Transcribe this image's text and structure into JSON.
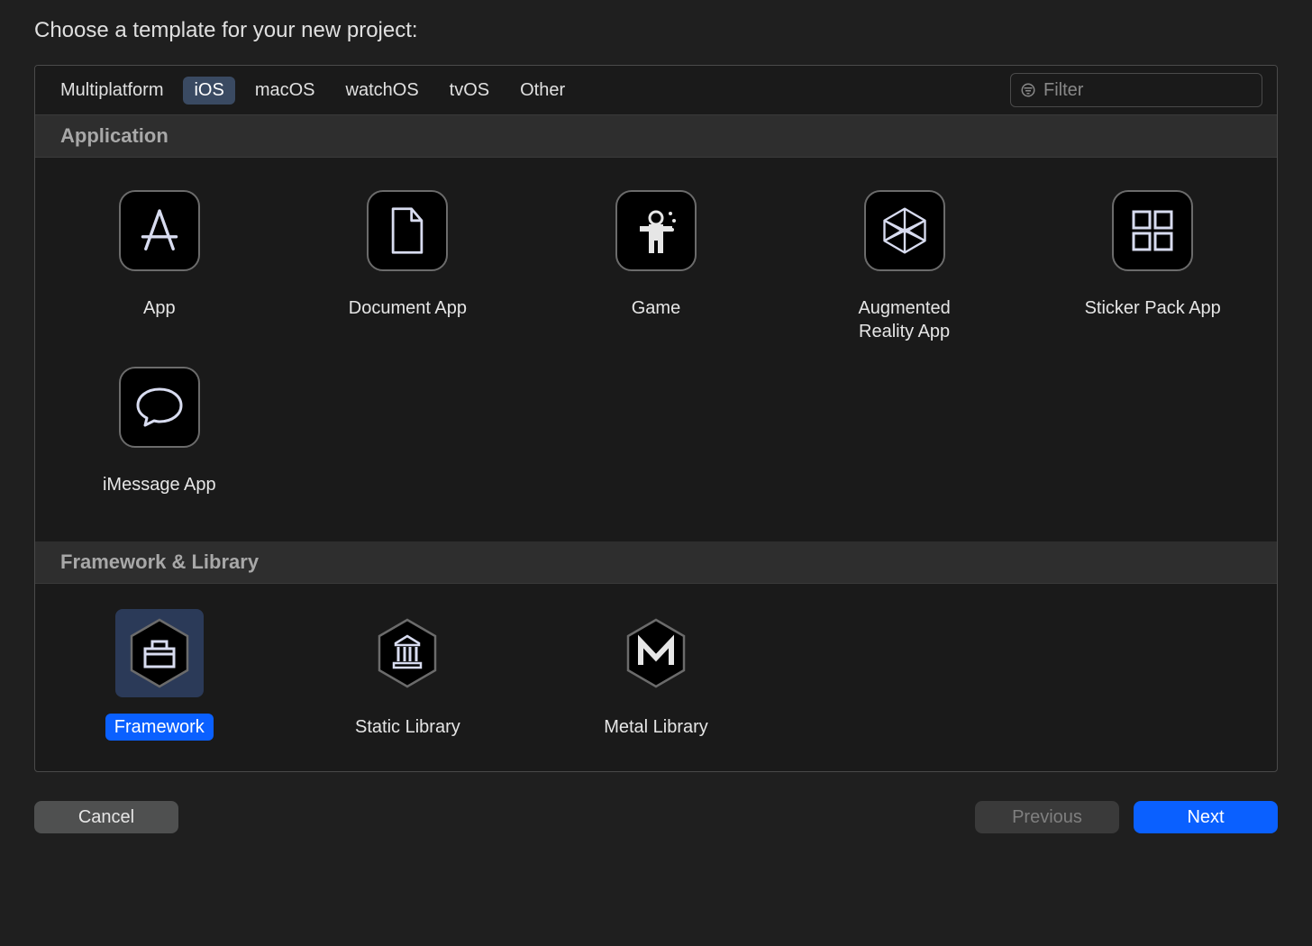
{
  "title": "Choose a template for your new project:",
  "tabs": [
    {
      "label": "Multiplatform",
      "selected": false
    },
    {
      "label": "iOS",
      "selected": true
    },
    {
      "label": "macOS",
      "selected": false
    },
    {
      "label": "watchOS",
      "selected": false
    },
    {
      "label": "tvOS",
      "selected": false
    },
    {
      "label": "Other",
      "selected": false
    }
  ],
  "filter": {
    "placeholder": "Filter",
    "value": ""
  },
  "sections": [
    {
      "title": "Application",
      "templates": [
        {
          "label": "App"
        },
        {
          "label": "Document App"
        },
        {
          "label": "Game"
        },
        {
          "label": "Augmented Reality App"
        },
        {
          "label": "Sticker Pack App"
        },
        {
          "label": "iMessage App"
        }
      ]
    },
    {
      "title": "Framework & Library",
      "templates": [
        {
          "label": "Framework",
          "selected": true
        },
        {
          "label": "Static Library"
        },
        {
          "label": "Metal Library"
        }
      ]
    }
  ],
  "buttons": {
    "cancel": "Cancel",
    "previous": "Previous",
    "next": "Next"
  }
}
